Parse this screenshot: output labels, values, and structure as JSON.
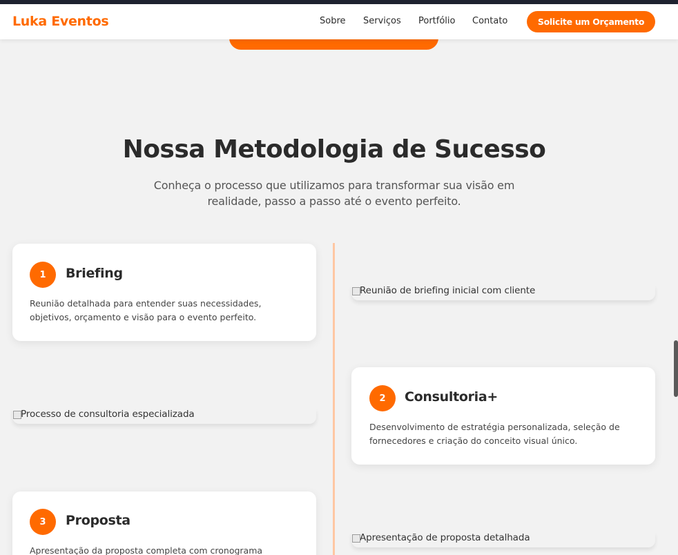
{
  "brand": "Luka Eventos",
  "nav": {
    "links": [
      "Sobre",
      "Serviços",
      "Portfólio",
      "Contato"
    ],
    "cta": "Solicite um Orçamento"
  },
  "section": {
    "title": "Nossa Metodologia de Sucesso",
    "subtitle": "Conheça o processo que utilizamos para transformar sua visão em realidade, passo a passo até o evento perfeito."
  },
  "steps": [
    {
      "number": "1",
      "title": "Briefing",
      "description": "Reunião detalhada para entender suas necessidades, objetivos, orçamento e visão para o evento perfeito.",
      "image_alt": "Reunião de briefing inicial com cliente"
    },
    {
      "number": "2",
      "title": "Consultoria+",
      "description": "Desenvolvimento de estratégia personalizada, seleção de fornecedores e criação do conceito visual único.",
      "image_alt": "Processo de consultoria especializada"
    },
    {
      "number": "3",
      "title": "Proposta",
      "description": "Apresentação da proposta completa com cronograma",
      "image_alt": "Apresentação de proposta detalhada"
    }
  ],
  "colors": {
    "accent": "#ff6a00",
    "timeline": "#ffc7a3",
    "background": "#f2f2f2"
  }
}
